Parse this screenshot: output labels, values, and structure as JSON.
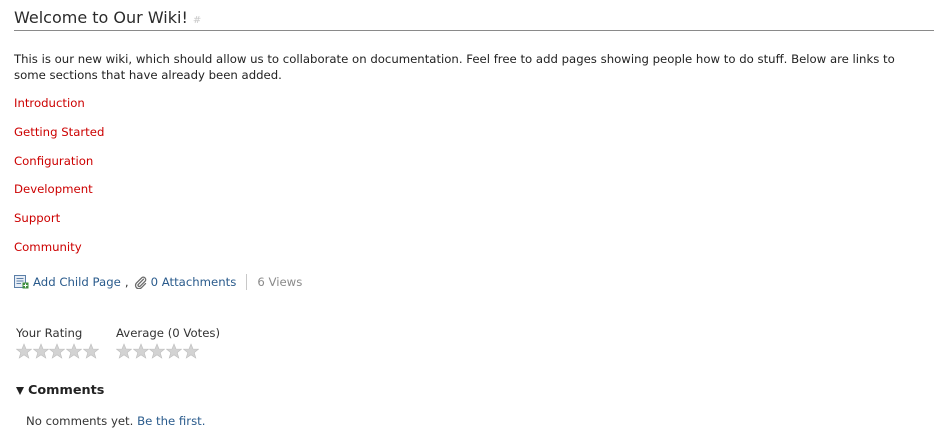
{
  "page": {
    "title": "Welcome to Our Wiki!",
    "permalink_glyph": "#",
    "intro": "This is our new wiki, which should allow us to collaborate on documentation. Feel free to add pages showing people how to do stuff. Below are links to some sections that have already been added."
  },
  "sections": [
    {
      "label": "Introduction"
    },
    {
      "label": "Getting Started"
    },
    {
      "label": "Configuration"
    },
    {
      "label": "Development"
    },
    {
      "label": "Support"
    },
    {
      "label": "Community"
    }
  ],
  "meta": {
    "add_child_page": "Add Child Page",
    "comma": ",",
    "attachments": "0 Attachments",
    "views": "6 Views",
    "add_child_icon": "page-add-icon",
    "attachment_icon": "paperclip-icon"
  },
  "rating": {
    "your_label": "Your Rating",
    "average_label": "Average (0 Votes)",
    "your_stars": 0,
    "average_stars": 0,
    "max_stars": 5
  },
  "comments": {
    "heading": "Comments",
    "empty_text": "No comments yet.",
    "first_link": "Be the first."
  },
  "colors": {
    "section_link": "#cc0000",
    "action_link": "#2a5b8c",
    "star_empty": "#d3d3d3"
  }
}
